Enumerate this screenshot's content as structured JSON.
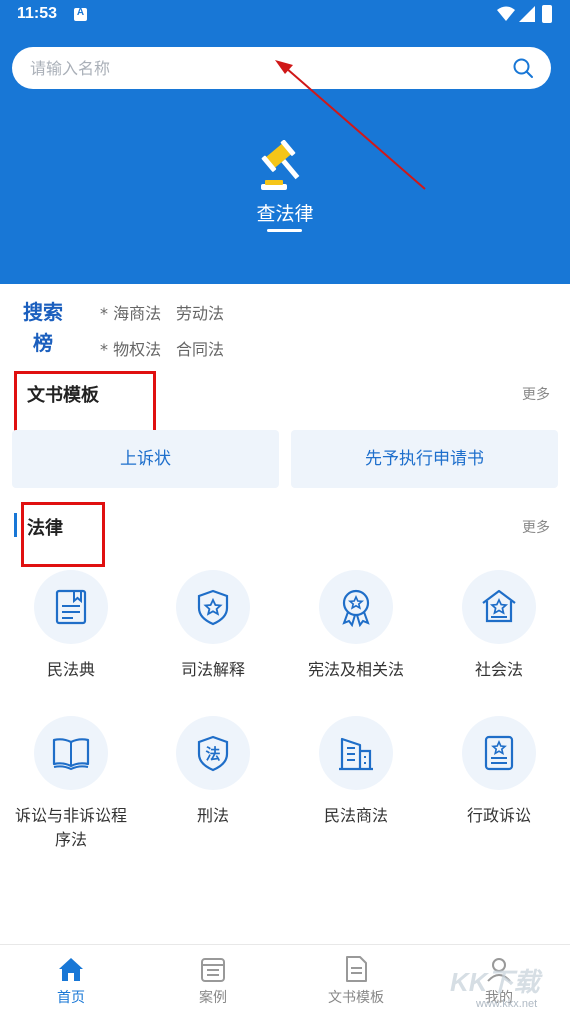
{
  "status": {
    "time": "11:53",
    "notif_icon_letter": "A",
    "icons": [
      "wifi-icon",
      "signal-icon",
      "battery-icon"
    ]
  },
  "search": {
    "placeholder": "请输入名称",
    "icon": "search-icon"
  },
  "header": {
    "title": "查法律",
    "logo_icon": "gavel-icon",
    "bg_color": "#1877d6"
  },
  "ranking": {
    "title_line1": "搜索",
    "title_line2": "榜",
    "items": [
      "* 海商法",
      "劳动法",
      "* 物权法",
      "合同法"
    ]
  },
  "templates": {
    "title": "文书模板",
    "more": "更多",
    "buttons": [
      "上诉状",
      "先予执行申请书"
    ]
  },
  "laws": {
    "title": "法律",
    "more": "更多",
    "items": [
      {
        "label": "民法典",
        "icon": "book-bookmark-icon"
      },
      {
        "label": "司法解释",
        "icon": "shield-star-icon"
      },
      {
        "label": "宪法及相关法",
        "icon": "medal-icon"
      },
      {
        "label": "社会法",
        "icon": "house-star-icon"
      },
      {
        "label": "诉讼与非诉讼程序法",
        "icon": "open-book-icon"
      },
      {
        "label": "刑法",
        "icon": "shield-law-icon"
      },
      {
        "label": "民法商法",
        "icon": "buildings-icon"
      },
      {
        "label": "行政诉讼",
        "icon": "document-star-icon"
      }
    ],
    "shield_char": "法"
  },
  "tabbar": {
    "items": [
      {
        "label": "首页",
        "icon": "home-icon",
        "active": true
      },
      {
        "label": "案例",
        "icon": "case-icon",
        "active": false
      },
      {
        "label": "文书模板",
        "icon": "document-icon",
        "active": false
      },
      {
        "label": "我的",
        "icon": "user-icon",
        "active": false
      }
    ]
  },
  "watermark": {
    "text": "KK下载",
    "url_text": "www.kkx.net"
  },
  "colors": {
    "accent": "#1877d6",
    "highlight_box": "#e01010",
    "arrow": "#d01818"
  }
}
